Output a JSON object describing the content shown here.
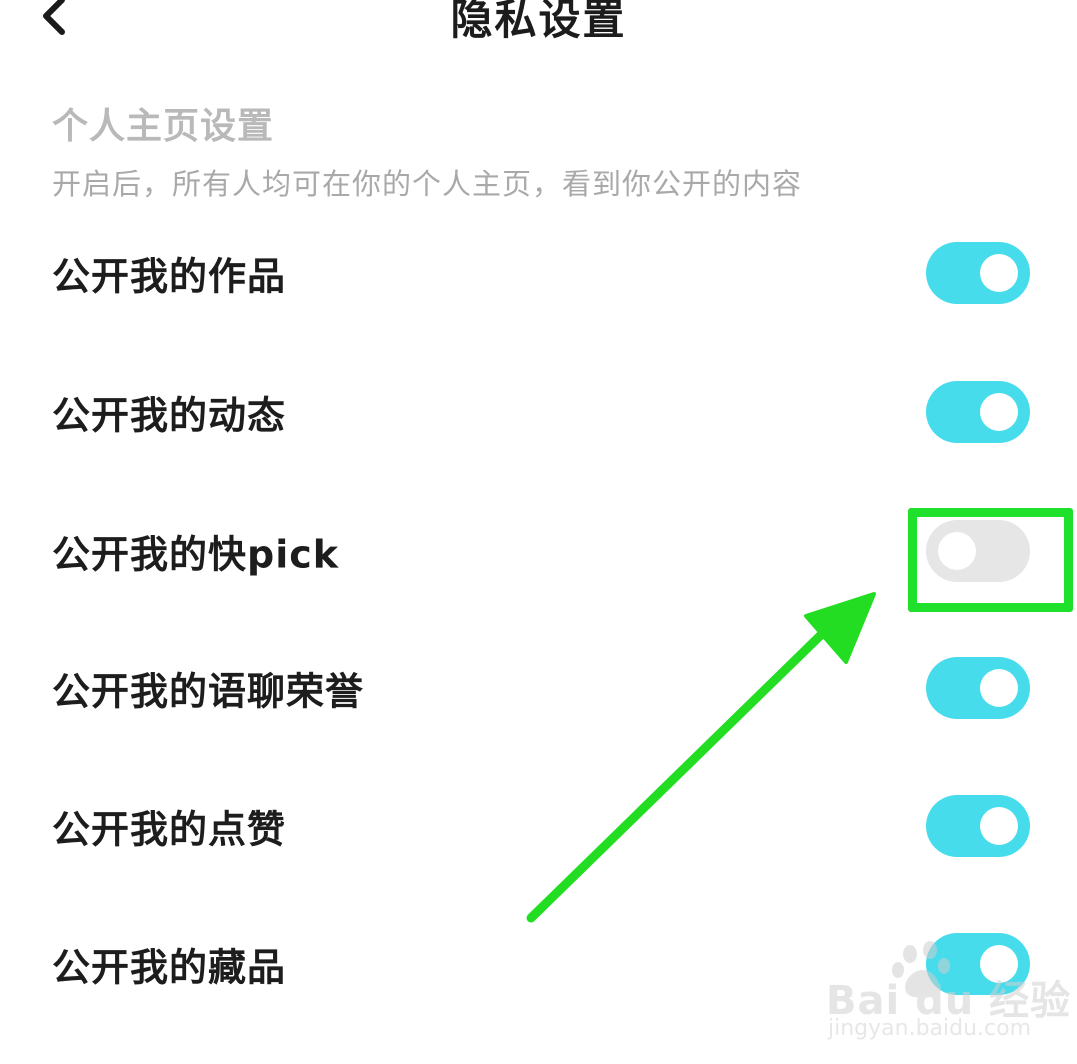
{
  "header": {
    "title": "隐私设置",
    "back_icon": "chevron-left-icon"
  },
  "section": {
    "title": "个人主页设置",
    "description": "开启后，所有人均可在你的个人主页，看到你公开的内容"
  },
  "settings": [
    {
      "label": "公开我的作品",
      "enabled": true
    },
    {
      "label": "公开我的动态",
      "enabled": true
    },
    {
      "label": "公开我的快pick",
      "enabled": false
    },
    {
      "label": "公开我的语聊荣誉",
      "enabled": true
    },
    {
      "label": "公开我的点赞",
      "enabled": true
    },
    {
      "label": "公开我的藏品",
      "enabled": true
    }
  ],
  "annotation": {
    "highlight_color": "#1fe02a",
    "arrow_color": "#22dd22",
    "target": "公开我的快pick"
  },
  "watermark": {
    "brand": "Bai du 经验",
    "url": "jingyan.baidu.com"
  },
  "colors": {
    "toggle_on": "#46dcec",
    "toggle_off": "#e6e6e6"
  }
}
